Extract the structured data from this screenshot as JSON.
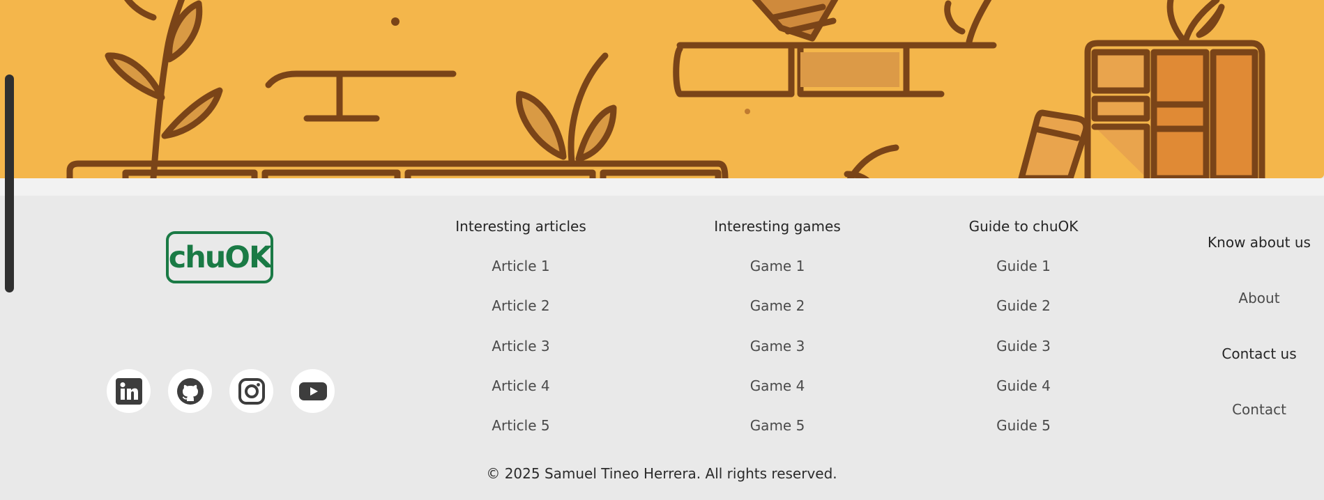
{
  "brand": {
    "logo_text": "chuOK",
    "logo_color": "#1a7a45"
  },
  "colors": {
    "hero_bg": "#f4b64b",
    "footer_bg": "#e9e9e9",
    "line": "#7a4418"
  },
  "social": [
    {
      "name": "linkedin",
      "icon": "linkedin-icon"
    },
    {
      "name": "github",
      "icon": "github-icon"
    },
    {
      "name": "instagram",
      "icon": "instagram-icon"
    },
    {
      "name": "youtube",
      "icon": "youtube-icon"
    }
  ],
  "columns": {
    "articles": {
      "title": "Interesting articles",
      "links": [
        "Article 1",
        "Article 2",
        "Article 3",
        "Article 4",
        "Article 5"
      ]
    },
    "games": {
      "title": "Interesting games",
      "links": [
        "Game 1",
        "Game 2",
        "Game 3",
        "Game 4",
        "Game 5"
      ]
    },
    "guides": {
      "title": "Guide to chuOK",
      "links": [
        "Guide 1",
        "Guide 2",
        "Guide 3",
        "Guide 4",
        "Guide 5"
      ]
    }
  },
  "know": {
    "title": "Know about us",
    "about": "About",
    "contact_title": "Contact us",
    "contact": "Contact"
  },
  "copyright": "© 2025 Samuel Tineo Herrera. All rights reserved."
}
